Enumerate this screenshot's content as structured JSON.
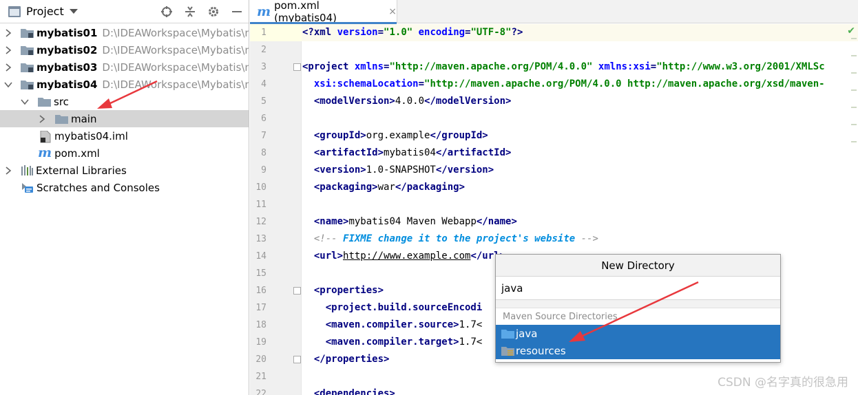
{
  "project_panel": {
    "title": "Project",
    "tools": [
      "locate-icon",
      "collapse-all-icon",
      "gear-icon",
      "minimize-icon"
    ],
    "tree": [
      {
        "id": "mybatis01",
        "label": "mybatis01",
        "path": "D:\\IDEAWorkspace\\Mybatis\\my",
        "expanded": false
      },
      {
        "id": "mybatis02",
        "label": "mybatis02",
        "path": "D:\\IDEAWorkspace\\Mybatis\\my",
        "expanded": false
      },
      {
        "id": "mybatis03",
        "label": "mybatis03",
        "path": "D:\\IDEAWorkspace\\Mybatis\\my",
        "expanded": false
      },
      {
        "id": "mybatis04",
        "label": "mybatis04",
        "path": "D:\\IDEAWorkspace\\Mybatis\\my",
        "expanded": true
      },
      {
        "id": "src",
        "label": "src"
      },
      {
        "id": "main",
        "label": "main",
        "selected": true
      },
      {
        "id": "iml",
        "label": "mybatis04.iml"
      },
      {
        "id": "pom",
        "label": "pom.xml"
      },
      {
        "id": "external",
        "label": "External Libraries"
      },
      {
        "id": "scratches",
        "label": "Scratches and Consoles"
      }
    ]
  },
  "editor": {
    "tab": {
      "label": "pom.xml (mybatis04)",
      "close": "×"
    },
    "line_numbers": [
      "1",
      "2",
      "3",
      "4",
      "5",
      "6",
      "7",
      "8",
      "9",
      "10",
      "11",
      "12",
      "13",
      "14",
      "15",
      "16",
      "17",
      "18",
      "19",
      "20",
      "21",
      "22"
    ],
    "code": {
      "l1_a": "<?xml ",
      "l1_b": "version",
      "l1_c": "=",
      "l1_d": "\"1.0\"",
      "l1_e": " ",
      "l1_f": "encoding",
      "l1_g": "=",
      "l1_h": "\"UTF-8\"",
      "l1_i": "?>",
      "l3_a": "<project ",
      "l3_b": "xmlns",
      "l3_c": "=",
      "l3_d": "\"http://maven.apache.org/POM/4.0.0\"",
      "l3_e": " ",
      "l3_f": "xmlns:xsi",
      "l3_g": "=",
      "l3_h": "\"http://www.w3.org/2001/XMLSc",
      "l4_a": "  ",
      "l4_b": "xsi:schemaLocation",
      "l4_c": "=",
      "l4_d": "\"http://maven.apache.org/POM/4.0.0 http://maven.apache.org/xsd/maven-",
      "l5": [
        "  ",
        "<modelVersion>",
        "4.0.0",
        "</modelVersion>"
      ],
      "l7": [
        "  ",
        "<groupId>",
        "org.example",
        "</groupId>"
      ],
      "l8": [
        "  ",
        "<artifactId>",
        "mybatis04",
        "</artifactId>"
      ],
      "l9": [
        "  ",
        "<version>",
        "1.0-SNAPSHOT",
        "</version>"
      ],
      "l10": [
        "  ",
        "<packaging>",
        "war",
        "</packaging>"
      ],
      "l12": [
        "  ",
        "<name>",
        "mybatis04 Maven Webapp",
        "</name>"
      ],
      "l13_a": "  <!-- ",
      "l13_b": "FIXME",
      "l13_c": " change it to the project's website",
      "l13_d": " -->",
      "l14": [
        "  ",
        "<url>",
        "http://www.example.com",
        "</url>"
      ],
      "l16": [
        "  ",
        "<properties>"
      ],
      "l17": [
        "    ",
        "<project.build.sourceEncodi"
      ],
      "l18": [
        "    ",
        "<maven.compiler.source>",
        "1.7<"
      ],
      "l19": [
        "    ",
        "<maven.compiler.target>",
        "1.7<"
      ],
      "l20": [
        "  ",
        "</properties>"
      ],
      "l22": [
        "  ",
        "<dependencies>"
      ]
    },
    "checkmark": "✔"
  },
  "popup": {
    "title": "New Directory",
    "input_value": "java",
    "group_label": "Maven Source Directories",
    "items": [
      {
        "label": "java",
        "icon": "source-folder-icon"
      },
      {
        "label": "resources",
        "icon": "resources-folder-icon"
      }
    ]
  },
  "watermark": "CSDN @名字真的很急用",
  "colors": {
    "selection": "#2675bf",
    "tag": "#000080",
    "attr": "#0000ff",
    "value": "#008000",
    "annotation_arrow": "#e8383d"
  }
}
